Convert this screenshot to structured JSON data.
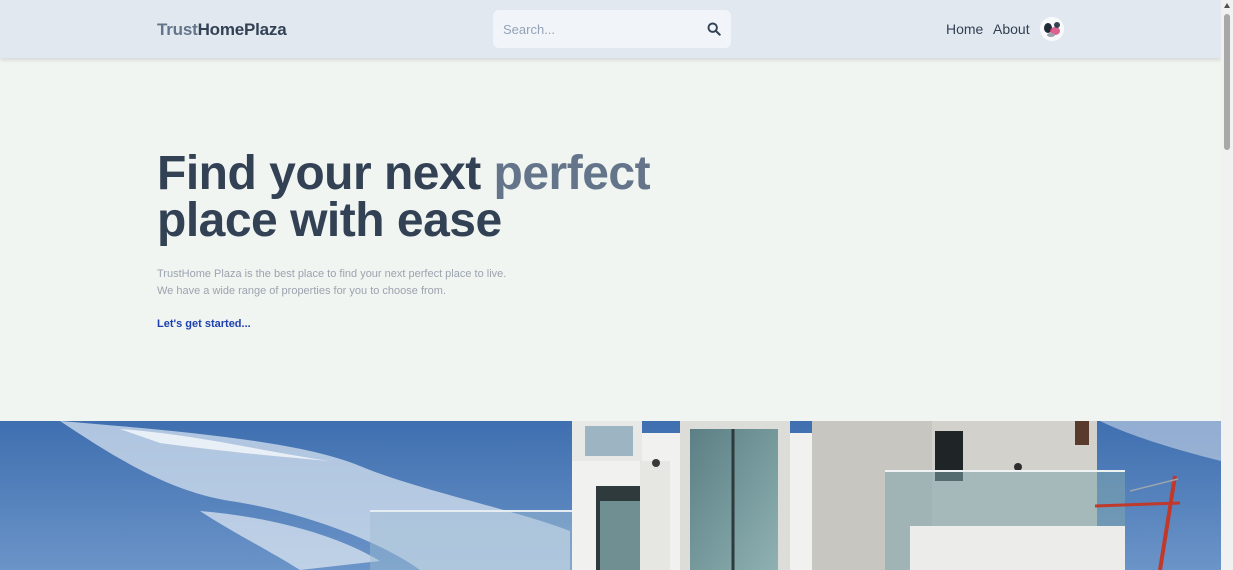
{
  "header": {
    "logo_part1": "Trust",
    "logo_part2": "HomePlaza",
    "search_placeholder": "Search...",
    "search_icon": "search-icon",
    "nav": {
      "home": "Home",
      "about": "About"
    },
    "avatar_icon": "user-avatar"
  },
  "hero": {
    "title_line1_a": "Find your next ",
    "title_line1_b": "perfect",
    "title_line2": "place with ease",
    "desc_line1": "TrustHome Plaza is the best place to find your next perfect place to live.",
    "desc_line2": "We have a wide range of properties for you to choose from.",
    "cta": "Let's get started..."
  },
  "colors": {
    "header_bg": "#e2e8f0",
    "page_bg": "#f1f5f1",
    "title_dark": "#334155",
    "title_accent": "#64748b",
    "cta": "#1e40af"
  }
}
